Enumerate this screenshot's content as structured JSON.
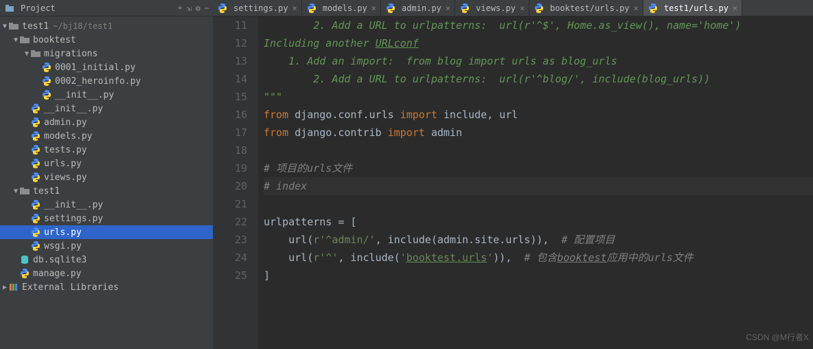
{
  "sidebar": {
    "header_label": "Project",
    "icons": {
      "target": "⌖",
      "collapse": "⇲",
      "gear": "⚙",
      "hide": "⎯"
    },
    "tree": [
      {
        "id": "root",
        "depth": 0,
        "arrow": "▼",
        "kind": "project",
        "label": "test1",
        "dim": "~/bj18/test1"
      },
      {
        "id": "booktest",
        "depth": 1,
        "arrow": "▼",
        "kind": "folder",
        "label": "booktest",
        "dim": ""
      },
      {
        "id": "migrations",
        "depth": 2,
        "arrow": "▼",
        "kind": "folder",
        "label": "migrations",
        "dim": ""
      },
      {
        "id": "mig1",
        "depth": 3,
        "arrow": "",
        "kind": "py",
        "label": "0001_initial.py",
        "dim": ""
      },
      {
        "id": "mig2",
        "depth": 3,
        "arrow": "",
        "kind": "py",
        "label": "0002_heroinfo.py",
        "dim": ""
      },
      {
        "id": "miginit",
        "depth": 3,
        "arrow": "",
        "kind": "py",
        "label": "__init__.py",
        "dim": ""
      },
      {
        "id": "btinit",
        "depth": 2,
        "arrow": "",
        "kind": "py",
        "label": "__init__.py",
        "dim": ""
      },
      {
        "id": "admin",
        "depth": 2,
        "arrow": "",
        "kind": "py",
        "label": "admin.py",
        "dim": ""
      },
      {
        "id": "models",
        "depth": 2,
        "arrow": "",
        "kind": "py",
        "label": "models.py",
        "dim": ""
      },
      {
        "id": "tests",
        "depth": 2,
        "arrow": "",
        "kind": "py",
        "label": "tests.py",
        "dim": ""
      },
      {
        "id": "bturls",
        "depth": 2,
        "arrow": "",
        "kind": "py",
        "label": "urls.py",
        "dim": ""
      },
      {
        "id": "views",
        "depth": 2,
        "arrow": "",
        "kind": "py",
        "label": "views.py",
        "dim": ""
      },
      {
        "id": "test1pkg",
        "depth": 1,
        "arrow": "▼",
        "kind": "folder",
        "label": "test1",
        "dim": ""
      },
      {
        "id": "t1init",
        "depth": 2,
        "arrow": "",
        "kind": "py",
        "label": "__init__.py",
        "dim": ""
      },
      {
        "id": "settings",
        "depth": 2,
        "arrow": "",
        "kind": "py",
        "label": "settings.py",
        "dim": ""
      },
      {
        "id": "t1urls",
        "depth": 2,
        "arrow": "",
        "kind": "py",
        "label": "urls.py",
        "dim": "",
        "selected": true
      },
      {
        "id": "wsgi",
        "depth": 2,
        "arrow": "",
        "kind": "py",
        "label": "wsgi.py",
        "dim": ""
      },
      {
        "id": "db",
        "depth": 1,
        "arrow": "",
        "kind": "db",
        "label": "db.sqlite3",
        "dim": ""
      },
      {
        "id": "manage",
        "depth": 1,
        "arrow": "",
        "kind": "py",
        "label": "manage.py",
        "dim": ""
      },
      {
        "id": "extlib",
        "depth": 0,
        "arrow": "▶",
        "kind": "lib",
        "label": "External Libraries",
        "dim": ""
      }
    ]
  },
  "tabs": [
    {
      "id": "settings",
      "label": "settings.py",
      "kind": "py",
      "active": false
    },
    {
      "id": "models",
      "label": "models.py",
      "kind": "py",
      "active": false
    },
    {
      "id": "admin",
      "label": "admin.py",
      "kind": "py",
      "active": false
    },
    {
      "id": "views",
      "label": "views.py",
      "kind": "py",
      "active": false
    },
    {
      "id": "bturls",
      "label": "booktest/urls.py",
      "kind": "py",
      "active": false
    },
    {
      "id": "t1urls",
      "label": "test1/urls.py",
      "kind": "py",
      "active": true
    }
  ],
  "code": {
    "first_line": 11,
    "lines": [
      {
        "n": 11,
        "segs": [
          {
            "t": "        2. Add a URL to urlpatterns:  url(r'^$', Home.as_view(), name='home')",
            "cls": "c-cmt"
          }
        ]
      },
      {
        "n": 12,
        "segs": [
          {
            "t": "Including another ",
            "cls": "c-cmt"
          },
          {
            "t": "URLconf",
            "cls": "c-cmt c-underline"
          }
        ]
      },
      {
        "n": 13,
        "segs": [
          {
            "t": "    1. Add an import:  from blog import urls as blog_urls",
            "cls": "c-cmt"
          }
        ]
      },
      {
        "n": 14,
        "segs": [
          {
            "t": "        2. Add a URL to urlpatterns:  url(r'^blog/', include(blog_urls))",
            "cls": "c-cmt"
          }
        ]
      },
      {
        "n": 15,
        "segs": [
          {
            "t": "\"\"\"",
            "cls": "c-docq"
          }
        ]
      },
      {
        "n": 16,
        "segs": [
          {
            "t": "from ",
            "cls": "c-kw"
          },
          {
            "t": "django.conf.urls ",
            "cls": "c-plain"
          },
          {
            "t": "import ",
            "cls": "c-kw"
          },
          {
            "t": "include, url",
            "cls": "c-plain"
          }
        ]
      },
      {
        "n": 17,
        "segs": [
          {
            "t": "from ",
            "cls": "c-kw"
          },
          {
            "t": "django.contrib ",
            "cls": "c-plain"
          },
          {
            "t": "import ",
            "cls": "c-kw"
          },
          {
            "t": "admin",
            "cls": "c-plain"
          }
        ]
      },
      {
        "n": 18,
        "segs": [
          {
            "t": "",
            "cls": "c-plain"
          }
        ]
      },
      {
        "n": 19,
        "segs": [
          {
            "t": "# 项目的urls文件",
            "cls": "c-grey"
          }
        ]
      },
      {
        "n": 20,
        "segs": [
          {
            "t": "# index",
            "cls": "c-grey"
          }
        ],
        "hl": true
      },
      {
        "n": 21,
        "segs": [
          {
            "t": "",
            "cls": "c-plain"
          }
        ]
      },
      {
        "n": 22,
        "segs": [
          {
            "t": "urlpatterns = [",
            "cls": "c-plain"
          }
        ]
      },
      {
        "n": 23,
        "segs": [
          {
            "t": "    url(",
            "cls": "c-plain"
          },
          {
            "t": "r'^admin/'",
            "cls": "c-str"
          },
          {
            "t": ", include(admin.site.urls)),",
            "cls": "c-plain"
          },
          {
            "t": "  # 配置项目",
            "cls": "c-grey"
          }
        ]
      },
      {
        "n": 24,
        "segs": [
          {
            "t": "    url(",
            "cls": "c-plain"
          },
          {
            "t": "r'^'",
            "cls": "c-str"
          },
          {
            "t": ", include(",
            "cls": "c-plain"
          },
          {
            "t": "'",
            "cls": "c-str"
          },
          {
            "t": "booktest.urls",
            "cls": "c-str c-underline"
          },
          {
            "t": "'",
            "cls": "c-str"
          },
          {
            "t": ")),",
            "cls": "c-plain"
          },
          {
            "t": "  # 包含",
            "cls": "c-grey"
          },
          {
            "t": "booktest",
            "cls": "c-grey c-underline-g"
          },
          {
            "t": "应用中的urls文件",
            "cls": "c-grey"
          }
        ]
      },
      {
        "n": 25,
        "segs": [
          {
            "t": "]",
            "cls": "c-plain"
          }
        ]
      }
    ]
  },
  "watermark": "CSDN @M行者X"
}
